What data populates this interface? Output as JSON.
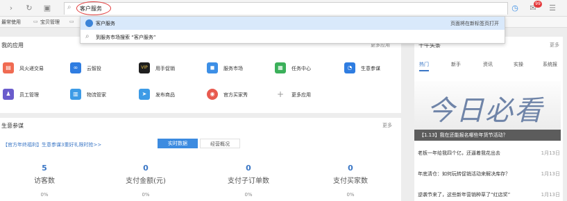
{
  "browser": {
    "address_text": "客户服务",
    "badge_count": "99"
  },
  "bookmarks": [
    "最常使用",
    "宝贝管理"
  ],
  "dropdown": {
    "item1_label": "客户服务",
    "item1_action": "页面将在新标签页打开",
    "item2_label": "到服务市场搜索 “客户服务”"
  },
  "my_apps": {
    "title": "我的应用",
    "more": "更多应用",
    "apps": [
      {
        "label": "风火递交易",
        "color": "#f06b52",
        "icon": "delivery-icon"
      },
      {
        "label": "云智投",
        "color": "#2f7de1",
        "icon": "infinity-icon"
      },
      {
        "label": "用手促销",
        "color": "#1f1f1f",
        "icon": "vip-icon"
      },
      {
        "label": "服务市场",
        "color": "#3d8fe6",
        "icon": "bag-icon"
      },
      {
        "label": "任务中心",
        "color": "#3bb05a",
        "icon": "calendar-icon"
      },
      {
        "label": "生意参谋",
        "color": "#2f7de1",
        "icon": "chart-icon"
      },
      {
        "label": "员工管理",
        "color": "#6a5ccc",
        "icon": "user-icon"
      },
      {
        "label": "物流管家",
        "color": "#3d9be6",
        "icon": "truck-icon"
      },
      {
        "label": "发布商品",
        "color": "#3d9be6",
        "icon": "send-icon"
      },
      {
        "label": "官方买家秀",
        "color": "#e85a4f",
        "icon": "camera-icon"
      },
      {
        "label": "更多应用",
        "color": "#ffffff",
        "icon": "plus-icon"
      }
    ]
  },
  "business": {
    "title": "生意参谋",
    "more": "更多",
    "promo_link": "【官方年终福利】生意参谋3重好礼限时抢>>",
    "tab_active": "实时数据",
    "tab_other": "经营概况",
    "stats": [
      {
        "value": "5",
        "label": "访客数",
        "pct": "0%"
      },
      {
        "value": "0",
        "label": "支付金额(元)",
        "pct": "0%"
      },
      {
        "value": "0",
        "label": "支付子订单数",
        "pct": "0%"
      },
      {
        "value": "0",
        "label": "支付买家数",
        "pct": "0%"
      }
    ]
  },
  "right_panel": {
    "title": "千牛头条",
    "more": "更多",
    "tabs": [
      "热门",
      "新手",
      "资讯",
      "实操",
      "系统报"
    ],
    "banner_text": "今日必看",
    "banner_caption": "【1.13】我在还能报名哪些年货节活动？",
    "news": [
      {
        "title": "老板一年给我四个亿，还逼着我花出去",
        "date": "1月13日"
      },
      {
        "title": "年底清仓：如何玩转促销活动来解决库存？",
        "date": "1月13日"
      },
      {
        "title": "逆袭节来了，这些新年营销种草了“红店奖”",
        "date": "1月13日"
      }
    ]
  }
}
